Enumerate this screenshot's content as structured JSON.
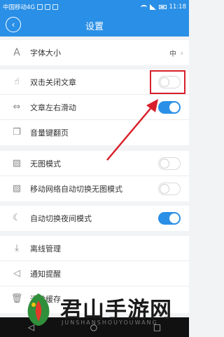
{
  "status_bar": {
    "carrier": "中国移动4G",
    "time": "11:18"
  },
  "header": {
    "title": "设置"
  },
  "settings": {
    "font_size": {
      "label": "字体大小",
      "value": "中"
    },
    "double_tap_close": {
      "label": "双击关闭文章",
      "state": "off"
    },
    "swipe_article": {
      "label": "文章左右滑动",
      "state": "on"
    },
    "volume_page": {
      "label": "音量键翻页"
    },
    "no_image": {
      "label": "无图模式",
      "state": "off"
    },
    "mobile_no_image": {
      "label": "移动网络自动切换无图模式",
      "state": "off"
    },
    "auto_night": {
      "label": "自动切换夜间模式",
      "state": "on"
    },
    "offline": {
      "label": "离线管理"
    },
    "notify": {
      "label": "通知提醒"
    },
    "clear_cache": {
      "label": "清除缓存"
    }
  },
  "watermark": {
    "text": "君山手游网",
    "sub": "JUNSHANSHOUYOUWANG"
  },
  "colors": {
    "primary": "#2a8fe6",
    "annotation_red": "#d8202b"
  }
}
